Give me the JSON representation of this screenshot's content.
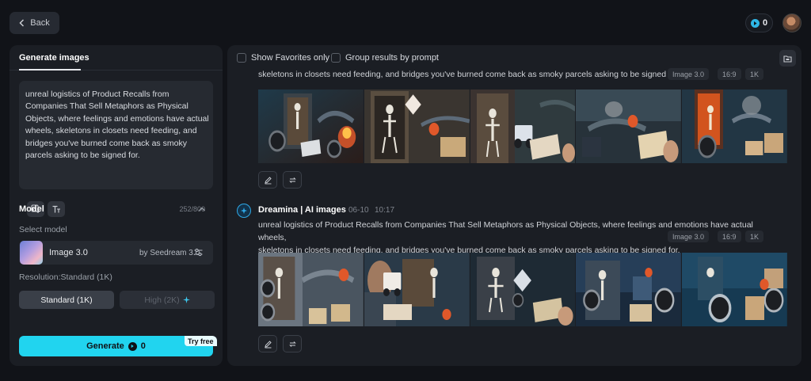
{
  "header": {
    "back_label": "Back",
    "credits": "0"
  },
  "left": {
    "tab": "Generate images",
    "prompt": "unreal logistics of Product Recalls from Companies That Sell Metaphors as Physical Objects, where feelings and emotions have actual wheels, skeletons in closets need feeding, and bridges you've burned come back as smoky parcels asking to be signed for.",
    "char_count": "252/800",
    "model_section_title": "Model",
    "select_model_label": "Select model",
    "model_name": "Image 3.0",
    "model_by": "by Seedream 3.0",
    "resolution_label": "Resolution:Standard (1K)",
    "res_standard": "Standard (1K)",
    "res_high": "High (2K)",
    "generate_label": "Generate",
    "generate_cost": "0",
    "try_free": "Try free"
  },
  "right": {
    "show_favorites": "Show Favorites only",
    "group_by_prompt": "Group results by prompt",
    "groups": [
      {
        "prompt_tail": "skeletons in closets need feeding, and bridges you've burned come back as smoky parcels asking to be signed for.",
        "tags": [
          "Image 3.0",
          "16:9",
          "1K"
        ]
      },
      {
        "author": "Dreamina | AI images",
        "date": "06-10",
        "time": "10:17",
        "prompt_line1": "unreal logistics of Product Recalls from Companies That Sell Metaphors as Physical Objects, where feelings and emotions have actual wheels,",
        "prompt_line2": "skeletons in closets need feeding, and bridges you've burned come back as smoky parcels asking to be signed for.",
        "tags": [
          "Image 3.0",
          "16:9",
          "1K"
        ]
      }
    ]
  },
  "icons": {
    "back": "chevron-left-icon",
    "credit": "credit-coin-icon",
    "collapse": "chevron-up-icon",
    "settings": "sliders-icon",
    "sparkle": "sparkle-icon",
    "folder": "folder-icon",
    "edit": "pencil-icon",
    "regenerate": "repeat-icon"
  },
  "colors": {
    "accent": "#21d4ef",
    "background": "#111318",
    "panel": "#1b1e24"
  }
}
